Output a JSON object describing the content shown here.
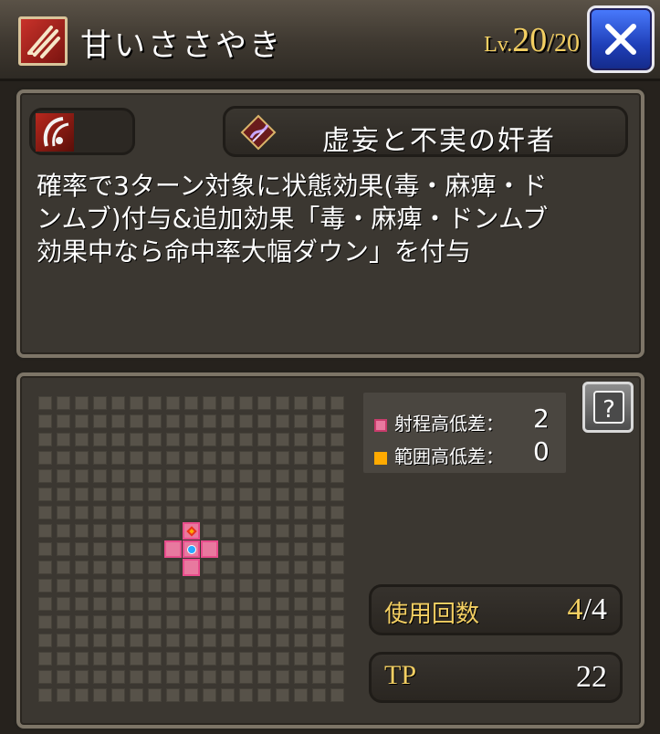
{
  "skill": {
    "name": "甘いささやき",
    "level_prefix": "Lv.",
    "level": "20",
    "level_max": "/20"
  },
  "effect": {
    "element_icon": "claw-slash-icon",
    "status_icon": "purple-gem-icon",
    "name": "虚妄と不実の奸者"
  },
  "description": {
    "lines": [
      "確率で3ターン対象に状態効果(毒・麻痺・ド",
      "ンムブ)付与&追加効果「毒・麻痺・ドンムブ",
      "効果中なら命中率大幅ダウン」を付与"
    ]
  },
  "range": {
    "grid_size": 17,
    "center": [
      8,
      8
    ],
    "range_cells": [
      [
        8,
        7
      ],
      [
        7,
        8
      ],
      [
        9,
        8
      ],
      [
        8,
        9
      ]
    ],
    "range_color": "#e84c8c",
    "area_color": "#ffaa00",
    "center_color": "#28a8ff",
    "legend": {
      "range_label": "射程高低差：",
      "range_value": "2",
      "area_label": "範囲高低差：",
      "area_value": "0"
    }
  },
  "stats": {
    "uses_label": "使用回数",
    "uses_current": "4",
    "uses_max": "/4",
    "tp_label": "TP",
    "tp_value": "22"
  },
  "colors": {
    "accent_gold": "#f3cf62",
    "close_blue": "#2848c8"
  }
}
